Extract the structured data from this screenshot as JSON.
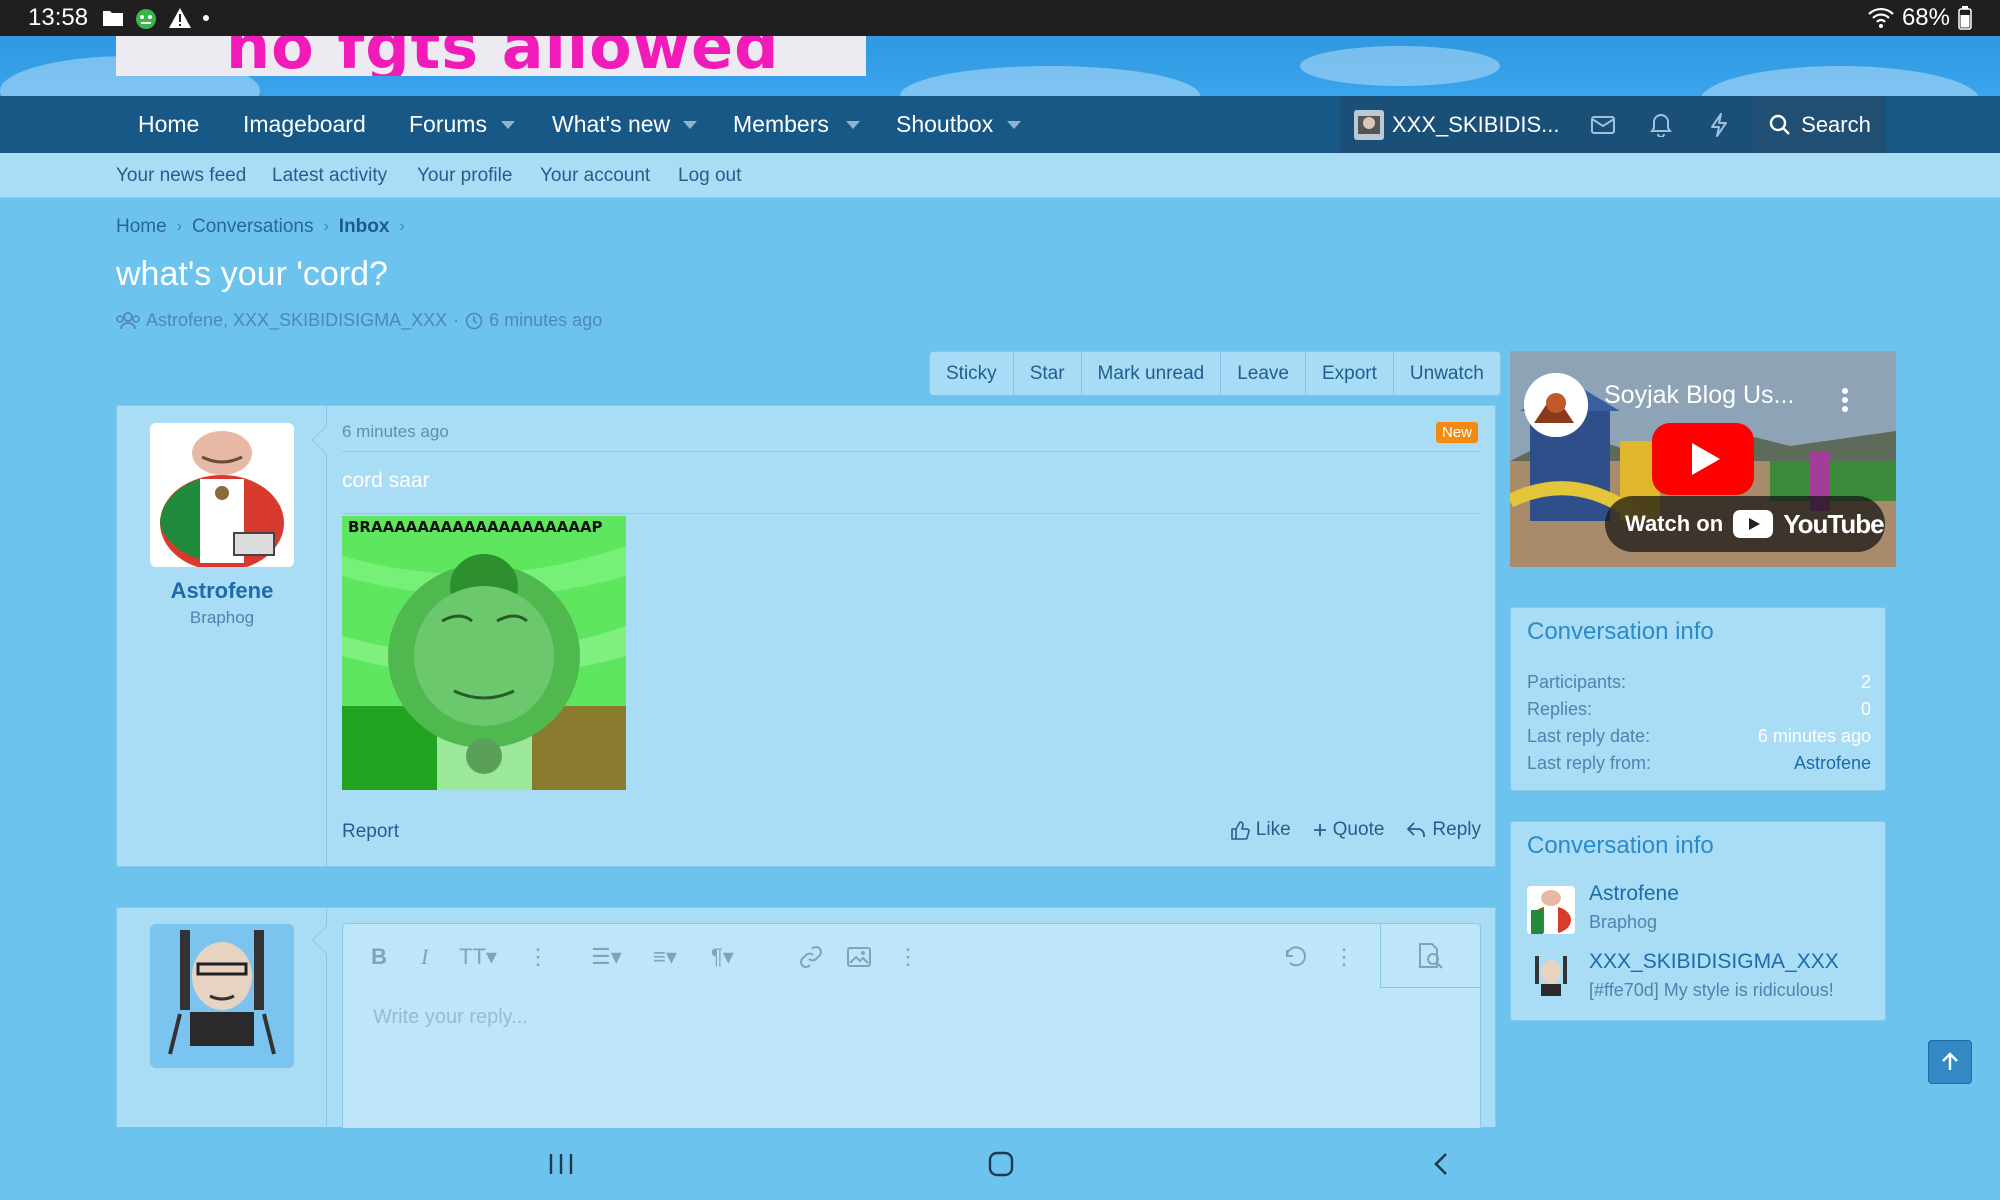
{
  "status_bar": {
    "time": "13:58",
    "battery": "68%"
  },
  "banner": {
    "text": "no fgts allowed"
  },
  "nav": {
    "items": [
      {
        "label": "Home"
      },
      {
        "label": "Imageboard"
      },
      {
        "label": "Forums"
      },
      {
        "label": "What's new"
      },
      {
        "label": "Members"
      },
      {
        "label": "Shoutbox"
      }
    ],
    "user_label": "XXX_SKIBIDIS...",
    "search_label": "Search"
  },
  "subnav": {
    "items": [
      {
        "label": "Your news feed"
      },
      {
        "label": "Latest activity"
      },
      {
        "label": "Your profile"
      },
      {
        "label": "Your account"
      },
      {
        "label": "Log out"
      }
    ]
  },
  "breadcrumb": {
    "home": "Home",
    "conversations": "Conversations",
    "inbox": "Inbox"
  },
  "page": {
    "title": "what's your 'cord?",
    "participants": "Astrofene, XXX_SKIBIDISIGMA_XXX",
    "time": "6 minutes ago"
  },
  "actions": [
    "Sticky",
    "Star",
    "Mark unread",
    "Leave",
    "Export",
    "Unwatch"
  ],
  "message": {
    "author": "Astrofene",
    "author_title": "Braphog",
    "time": "6 minutes ago",
    "badge": "New",
    "text": "cord saar",
    "image_caption": "BRAAAAAAAAAAAAAAAAAAAP",
    "report": "Report",
    "like": "Like",
    "quote": "Quote",
    "reply": "Reply"
  },
  "reply_editor": {
    "placeholder": "Write your reply..."
  },
  "video": {
    "title": "Soyjak Blog Us...",
    "watch_on": "Watch on",
    "brand": "YouTube"
  },
  "conversation_info": {
    "title": "Conversation info",
    "rows": [
      {
        "label": "Participants:",
        "value": "2"
      },
      {
        "label": "Replies:",
        "value": "0"
      },
      {
        "label": "Last reply date:",
        "value": "6 minutes ago"
      },
      {
        "label": "Last reply from:",
        "value": "Astrofene"
      }
    ]
  },
  "participants_box": {
    "title": "Conversation info",
    "people": [
      {
        "name": "Astrofene",
        "subtitle": "Braphog"
      },
      {
        "name": "XXX_SKIBIDISIGMA_XXX",
        "subtitle": "[#ffe70d] My style is ridiculous!"
      }
    ]
  },
  "colors": {
    "nav_bg": "#185886",
    "page_bg": "#6cc3ee",
    "subnav_bg": "#a9ddf6",
    "badge_new": "#f28a13",
    "link": "#1f6aa9"
  }
}
